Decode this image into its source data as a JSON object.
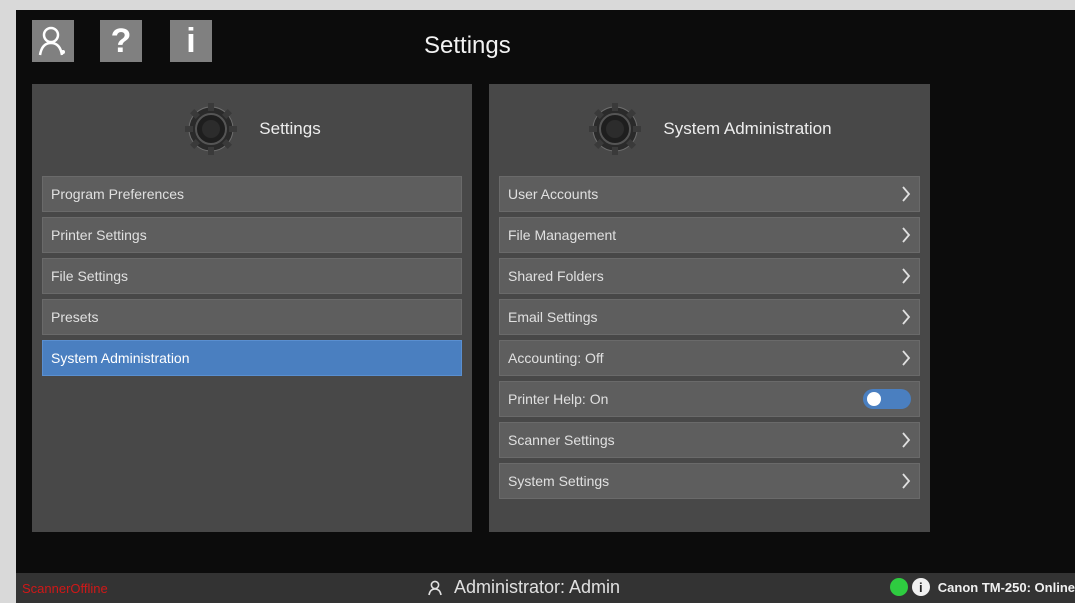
{
  "header": {
    "title": "Settings",
    "help_label": "?",
    "info_label": "i"
  },
  "left_panel": {
    "title": "Settings",
    "items": [
      {
        "label": "Program Preferences"
      },
      {
        "label": "Printer Settings"
      },
      {
        "label": "File Settings"
      },
      {
        "label": "Presets"
      },
      {
        "label": "System Administration",
        "selected": true
      }
    ]
  },
  "right_panel": {
    "title": "System Administration",
    "items": [
      {
        "label": "User Accounts",
        "control": "chevron"
      },
      {
        "label": "File Management",
        "control": "chevron"
      },
      {
        "label": "Shared Folders",
        "control": "chevron"
      },
      {
        "label": "Email Settings",
        "control": "chevron"
      },
      {
        "label": "Accounting: Off",
        "control": "chevron"
      },
      {
        "label": "Printer Help: On",
        "control": "toggle",
        "toggle_on": true
      },
      {
        "label": "Scanner Settings",
        "control": "chevron"
      },
      {
        "label": "System Settings",
        "control": "chevron"
      }
    ]
  },
  "status_bar": {
    "scanner_status": "ScannerOffline",
    "user": "Administrator: Admin",
    "printer": "Canon TM-250: Online",
    "info_icon_label": "i"
  },
  "colors": {
    "accent": "#4a7fc0",
    "online": "#2ecc40",
    "offline": "#d01818"
  },
  "icons": [
    "user-icon",
    "help-icon",
    "info-icon",
    "gear-icon",
    "chevron-right-icon",
    "status-dot-icon"
  ]
}
